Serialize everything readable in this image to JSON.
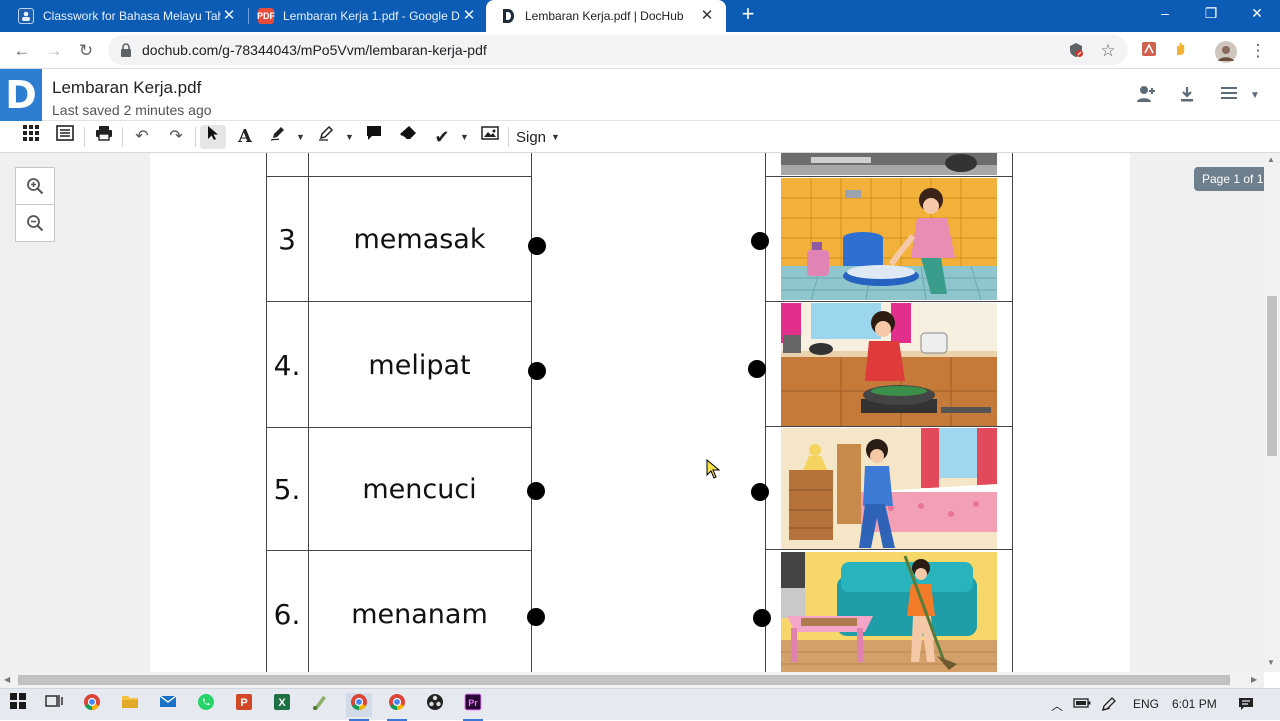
{
  "browser": {
    "tabs": [
      {
        "title": "Classwork for Bahasa Melayu Tah",
        "favicon": "classroom-icon",
        "active": false
      },
      {
        "title": "Lembaran Kerja 1.pdf - Google D",
        "favicon": "pdf-icon",
        "favicon_text": "PDF",
        "active": false
      },
      {
        "title": "Lembaran Kerja.pdf | DocHub",
        "favicon": "dochub-icon",
        "active": true
      }
    ],
    "new_tab": "+",
    "window_controls": {
      "minimize": "–",
      "restore": "❐",
      "close": "✕"
    },
    "url": "dochub.com/g-78344043/mPo5Vvm/lembaran-kerja-pdf"
  },
  "app": {
    "logo": "D",
    "title": "Lembaran Kerja.pdf",
    "saved": "Last saved 2 minutes ago",
    "sign_label": "Sign",
    "page_indicator": "Page 1 of 1",
    "accent": "#2d7dd2"
  },
  "worksheet": {
    "rows": [
      {
        "num": "3",
        "word": "memasak"
      },
      {
        "num": "4.",
        "word": "melipat"
      },
      {
        "num": "5.",
        "word": "mencuci"
      },
      {
        "num": "6.",
        "word": "menanam"
      }
    ]
  },
  "taskbar": {
    "language": "ENG",
    "time": "6:01 PM"
  }
}
